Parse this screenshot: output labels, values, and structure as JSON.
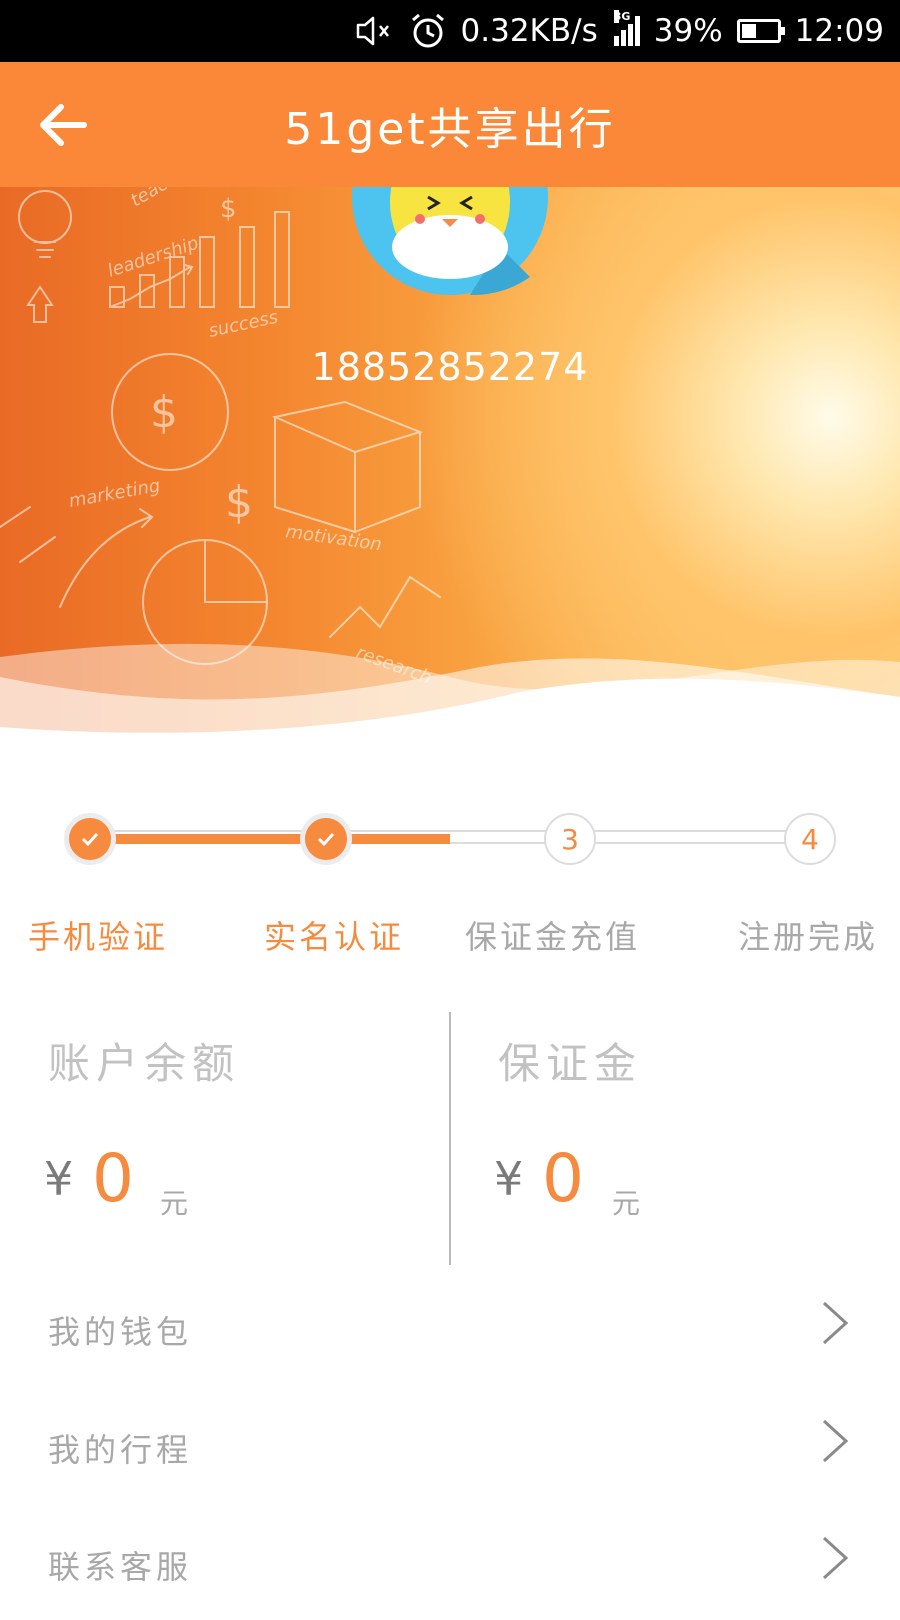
{
  "status_bar": {
    "speed": "0.32KB/s",
    "network": "3G",
    "battery_percent": "39%",
    "battery_level": 0.39,
    "time": "12:09",
    "icons": [
      "mute-icon",
      "alarm-icon",
      "signal-icon",
      "battery-icon"
    ]
  },
  "header": {
    "title": "51get共享出行",
    "back_icon": "back-arrow-icon"
  },
  "profile": {
    "phone": "18852852274",
    "avatar_icon": "penguin-avatar-icon"
  },
  "steps": [
    {
      "label": "手机验证",
      "status": "done"
    },
    {
      "label": "实名认证",
      "status": "done"
    },
    {
      "number": "3",
      "label": "保证金充值",
      "status": "todo"
    },
    {
      "number": "4",
      "label": "注册完成",
      "status": "todo"
    }
  ],
  "balances": {
    "account": {
      "title": "账户余额",
      "currency": "¥",
      "amount": "0",
      "unit": "元"
    },
    "deposit": {
      "title": "保证金",
      "currency": "¥",
      "amount": "0",
      "unit": "元"
    }
  },
  "menu": [
    {
      "label": "我的钱包"
    },
    {
      "label": "我的行程"
    },
    {
      "label": "联系客服"
    }
  ],
  "colors": {
    "accent": "#f68a3e",
    "header": "#fb8838",
    "muted_text": "#a8a8a8"
  }
}
